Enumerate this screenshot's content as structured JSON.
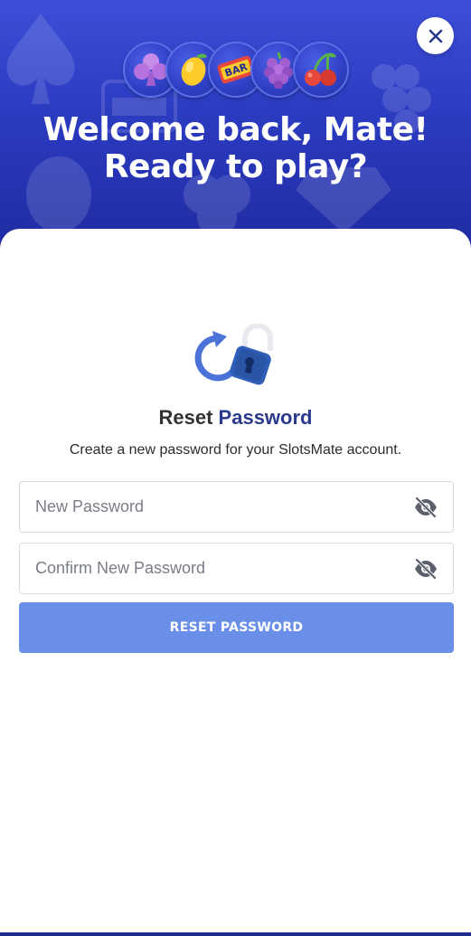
{
  "hero": {
    "title_line1": "Welcome back, Mate!",
    "title_line2": "Ready to play?",
    "coins": [
      "club-icon",
      "lemon-icon",
      "bar-icon",
      "grapes-icon",
      "cherry-icon"
    ],
    "bar_label": "BAR"
  },
  "close": {
    "icon": "close-icon"
  },
  "reset": {
    "heading_part1": "Reset",
    "heading_part2": "Password",
    "subtitle": "Create a new password for your SlotsMate account.",
    "new_password": {
      "placeholder": "New Password",
      "value": ""
    },
    "confirm_password": {
      "placeholder": "Confirm New Password",
      "value": ""
    },
    "submit_label": "RESET PASSWORD"
  },
  "colors": {
    "hero_bg": "#2b3bc0",
    "accent": "#2a3a8c",
    "button": "#6a8fe8",
    "icon_blue": "#4a72d9"
  }
}
